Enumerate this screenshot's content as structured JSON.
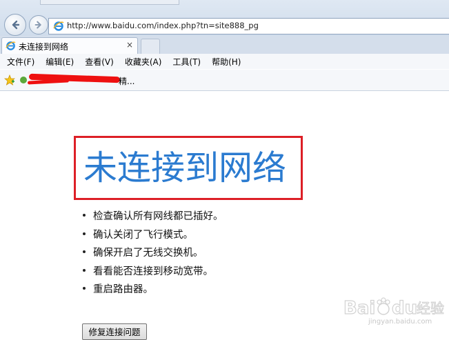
{
  "browser": {
    "address_url": "http://www.baidu.com/index.php?tn=site888_pg",
    "tab": {
      "title": "未连接到网络",
      "close_symbol": "×"
    },
    "menu": [
      "文件(F)",
      "编辑(E)",
      "查看(V)",
      "收藏夹(A)",
      "工具(T)",
      "帮助(H)"
    ],
    "favorites": {
      "visible_text": "精..."
    }
  },
  "page": {
    "error_title": "未连接到网络",
    "tips": [
      "检查确认所有网线都已插好。",
      "确认关闭了飞行模式。",
      "确保开启了无线交换机。",
      "看看能否连接到移动宽带。",
      "重启路由器。"
    ],
    "fix_button_label": "修复连接问题"
  },
  "watermark": {
    "brand": "Baidu 经验",
    "sub": "jingyan.baidu.com"
  },
  "colors": {
    "title_blue": "#2b7bd0",
    "highlight_red": "#dd1f26",
    "redaction_red": "#ee1010"
  }
}
